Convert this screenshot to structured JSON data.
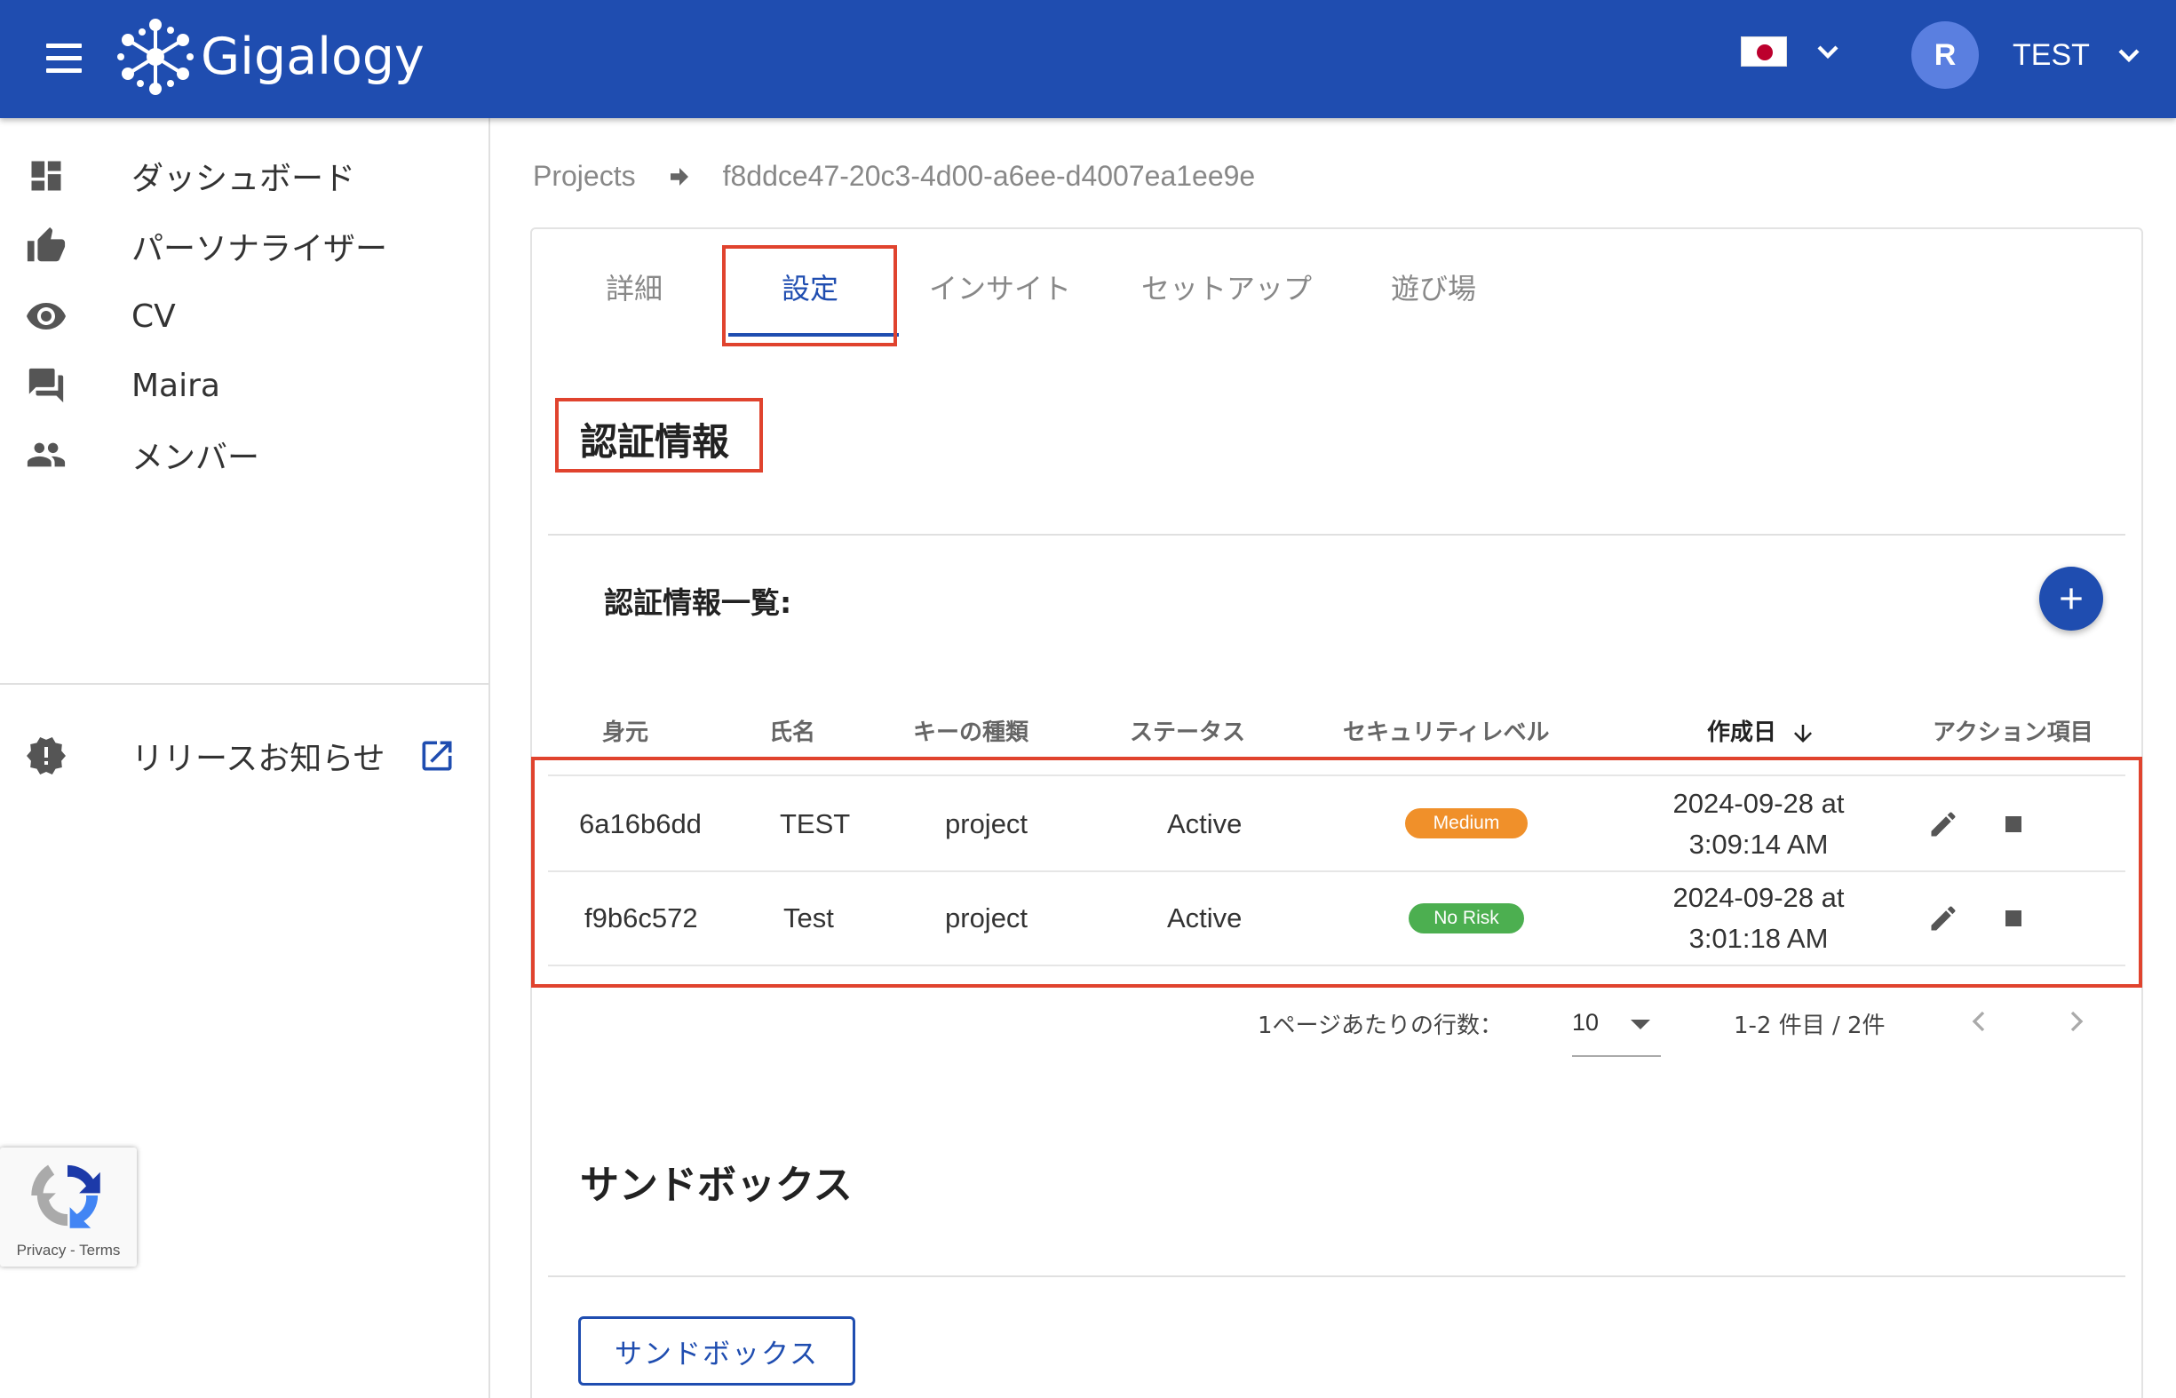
{
  "header": {
    "brand": "Gigalogy",
    "language_flag": "jp-flag-icon",
    "user_initial": "R",
    "user_name": "TEST"
  },
  "sidebar": {
    "items": [
      {
        "label": "ダッシュボード",
        "icon": "dashboard-icon"
      },
      {
        "label": "パーソナライザー",
        "icon": "thumb-up-icon"
      },
      {
        "label": "CV",
        "icon": "eye-icon"
      },
      {
        "label": "Maira",
        "icon": "chat-icon"
      },
      {
        "label": "メンバー",
        "icon": "people-icon"
      },
      {
        "label": "リリースお知らせ",
        "icon": "alert-badge-icon"
      }
    ]
  },
  "recaptcha": {
    "links": "Privacy - Terms"
  },
  "breadcrumb": {
    "root": "Projects",
    "current": "f8ddce47-20c3-4d00-a6ee-d4007ea1ee9e"
  },
  "tabs": [
    "詳細",
    "設定",
    "インサイト",
    "セットアップ",
    "遊び場"
  ],
  "active_tab": "設定",
  "credentials": {
    "title": "認証情報",
    "list_title": "認証情報一覧:",
    "columns": [
      "身元",
      "氏名",
      "キーの種類",
      "ステータス",
      "セキュリティレベル",
      "作成日",
      "アクション項目"
    ],
    "rows": [
      {
        "id": "6a16b6dd",
        "name": "TEST",
        "key_type": "project",
        "status": "Active",
        "security": "Medium",
        "created_line1": "2024-09-28 at",
        "created_line2": "3:09:14 AM"
      },
      {
        "id": "f9b6c572",
        "name": "Test",
        "key_type": "project",
        "status": "Active",
        "security": "No Risk",
        "created_line1": "2024-09-28 at",
        "created_line2": "3:01:18 AM"
      }
    ],
    "pagination": {
      "rows_per_page_label": "1ページあたりの行数：",
      "rows_per_page": "10",
      "range": "1-2 件目 / 2件"
    }
  },
  "sandbox": {
    "title": "サンドボックス",
    "button": "サンドボックス"
  },
  "colors": {
    "primary": "#1f4db0",
    "highlight": "#e0432e",
    "medium_badge": "#f0902a",
    "norisk_badge": "#4caf50"
  }
}
